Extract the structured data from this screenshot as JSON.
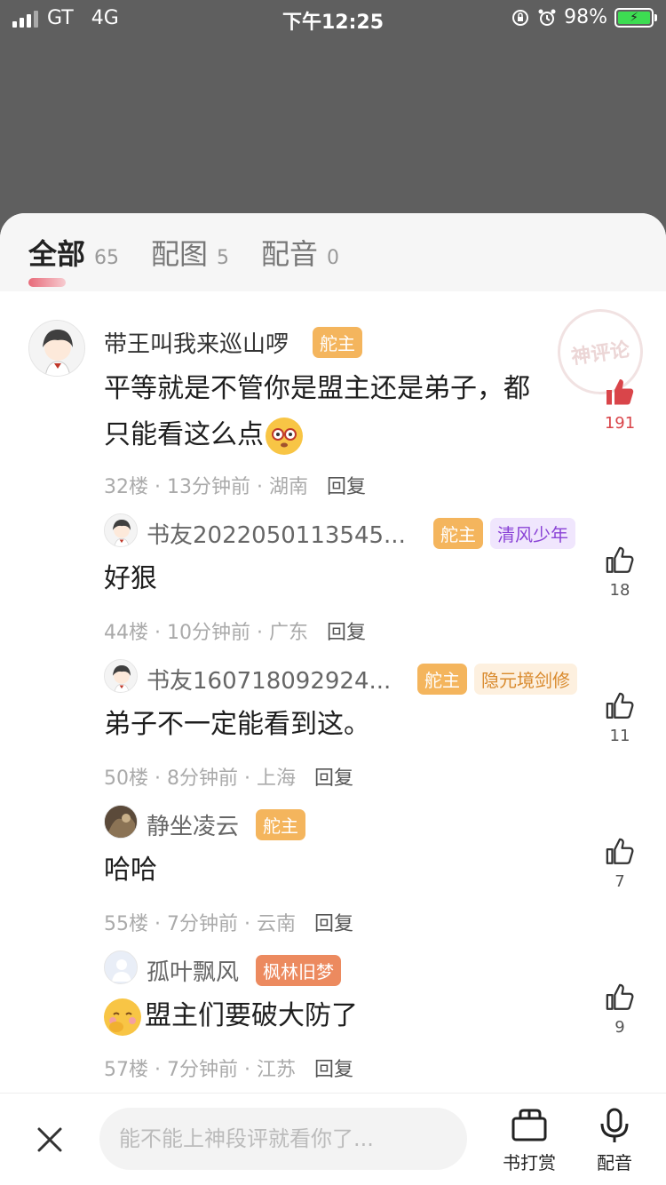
{
  "status_bar": {
    "carrier": "GT",
    "network": "4G",
    "time": "下午12:25",
    "battery": "98%"
  },
  "tabs": [
    {
      "label": "全部",
      "count": "65",
      "active": true
    },
    {
      "label": "配图",
      "count": "5"
    },
    {
      "label": "配音",
      "count": "0"
    }
  ],
  "stamp_text": "神评论",
  "comments": [
    {
      "user": "带王叫我来巡山啰",
      "badges": [
        "舵主"
      ],
      "text_line1": "平等就是不管你是盟主还是弟子，都",
      "text_line2": "只能看这么点",
      "floor": "32楼",
      "time": "13分钟前",
      "region": "湖南",
      "reply": "回复",
      "likes": "191",
      "liked": true
    },
    {
      "user": "书友2022050113545...",
      "badges": [
        "舵主",
        "清风少年"
      ],
      "text": "好狠",
      "floor": "44楼",
      "time": "10分钟前",
      "region": "广东",
      "reply": "回复",
      "likes": "18"
    },
    {
      "user": "书友160718092924...",
      "badges": [
        "舵主",
        "隐元境剑修"
      ],
      "text": "弟子不一定能看到这。",
      "floor": "50楼",
      "time": "8分钟前",
      "region": "上海",
      "reply": "回复",
      "likes": "11"
    },
    {
      "user": "静坐凌云",
      "badges": [
        "舵主"
      ],
      "text": "哈哈",
      "floor": "55楼",
      "time": "7分钟前",
      "region": "云南",
      "reply": "回复",
      "likes": "7"
    },
    {
      "user": "孤叶飘风",
      "badges": [
        "枫林旧梦"
      ],
      "text": "盟主们要破大防了",
      "floor": "57楼",
      "time": "7分钟前",
      "region": "江苏",
      "reply": "回复",
      "likes": "9"
    }
  ],
  "meta_sep": "·",
  "bottom": {
    "input_placeholder": "能不能上神段评就看你了...",
    "tip_label": "书打赏",
    "voice_label": "配音"
  },
  "colors": {
    "accent_red": "#d9454a",
    "badge_orange": "#f4b55d",
    "badge_purple_text": "#8a43d6",
    "badge_coral": "#ec8a5f"
  }
}
